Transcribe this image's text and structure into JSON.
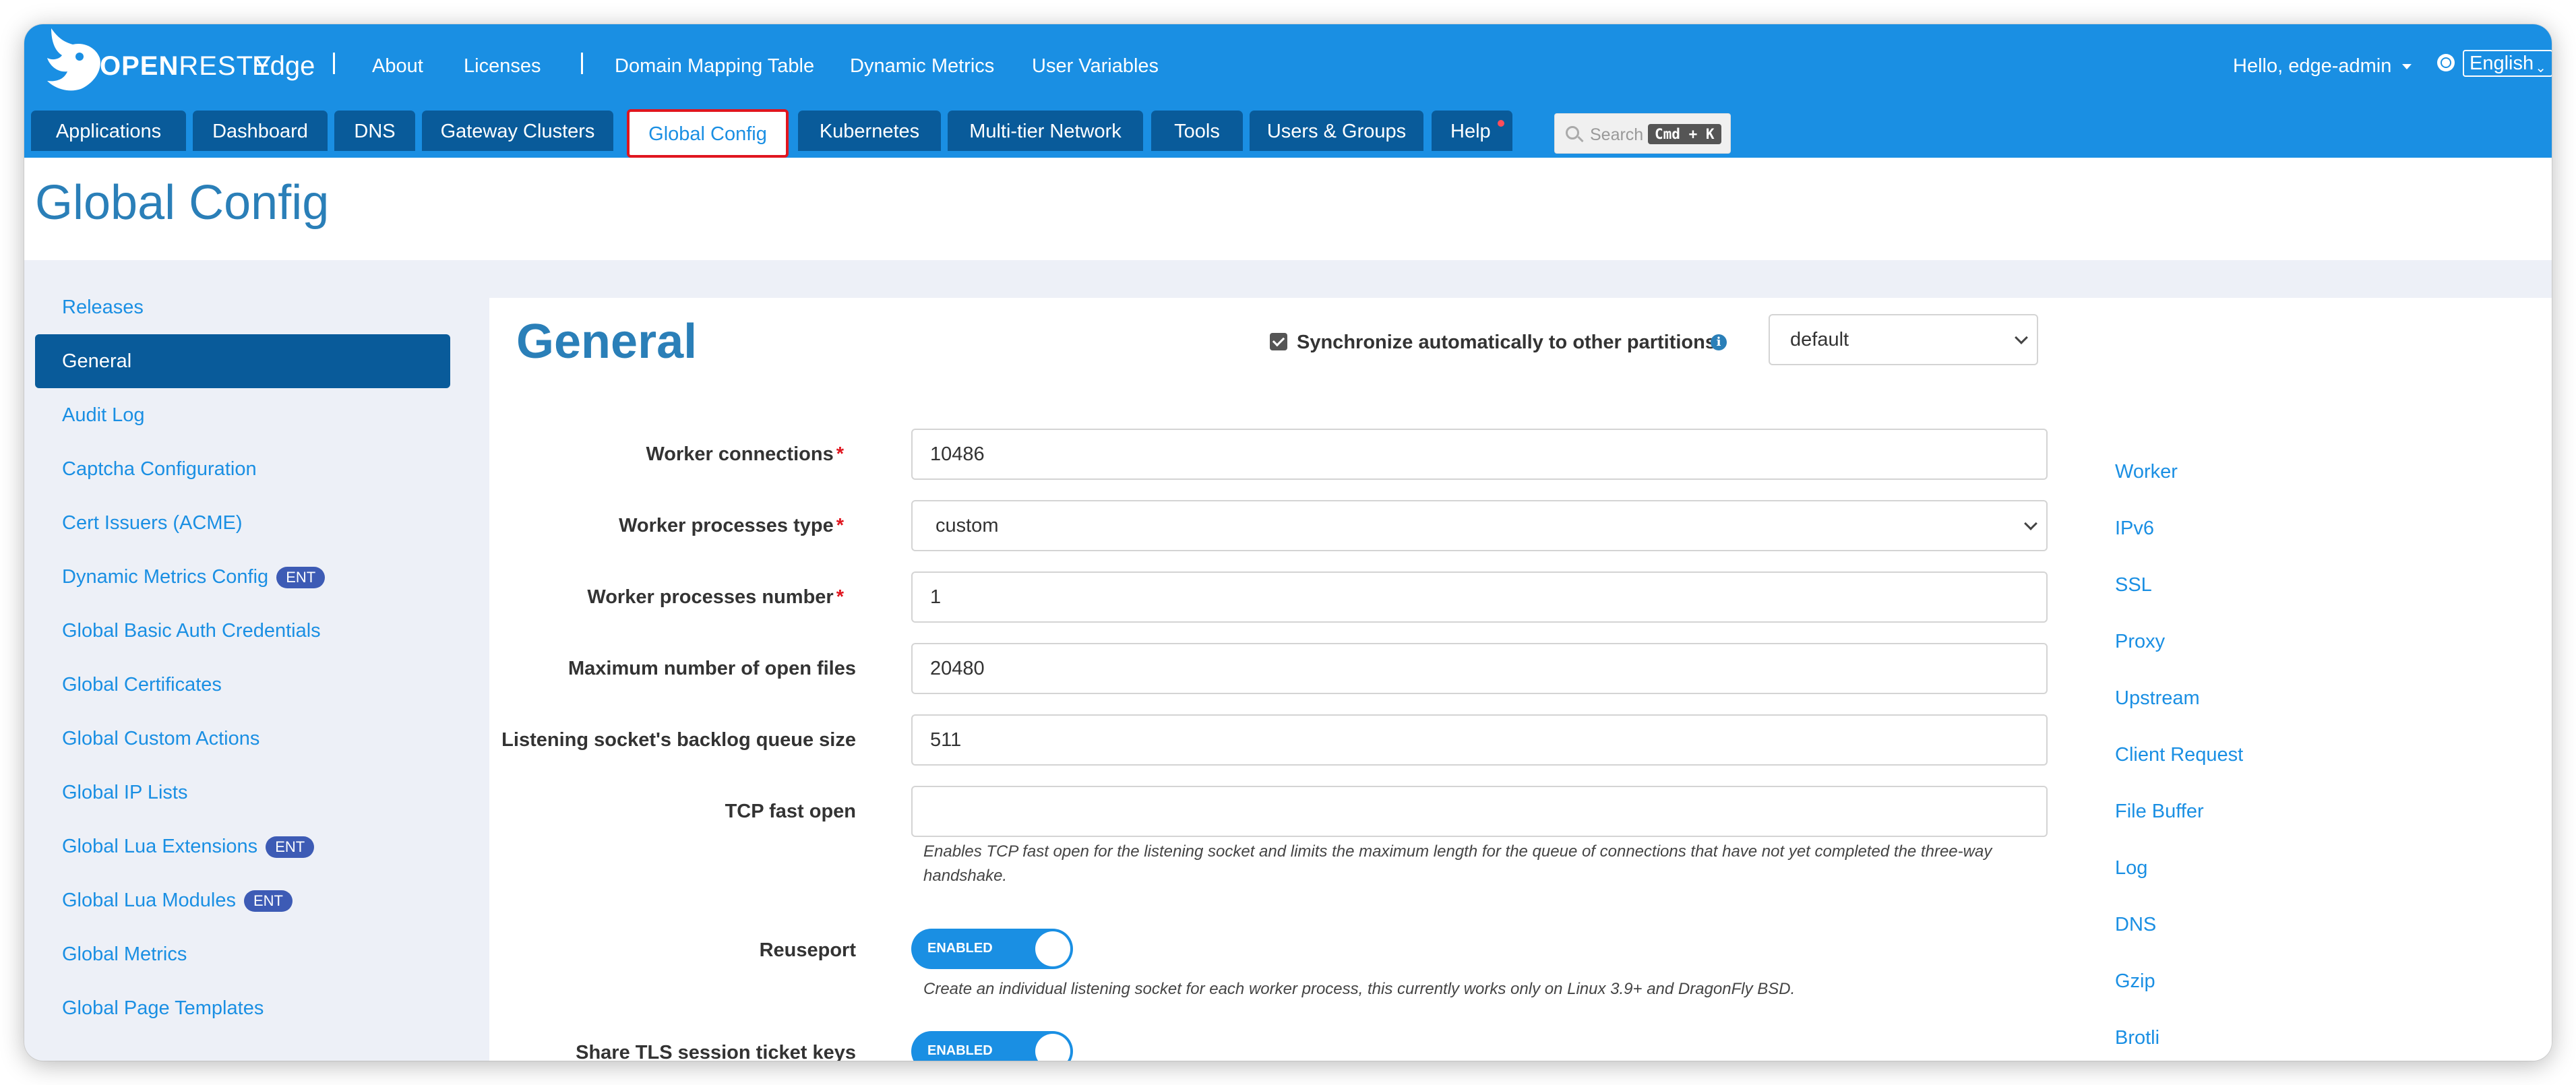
{
  "header": {
    "logo_text_bold": "OPEN",
    "logo_text_thin": "RESTY",
    "logo_product": "Edge",
    "nav": [
      "About",
      "Licenses",
      "Domain Mapping Table",
      "Dynamic Metrics",
      "User Variables"
    ],
    "user_greeting": "Hello, edge-admin",
    "language": "English"
  },
  "tabs": [
    {
      "label": "Applications"
    },
    {
      "label": "Dashboard"
    },
    {
      "label": "DNS"
    },
    {
      "label": "Gateway Clusters"
    },
    {
      "label": "Global Config",
      "active": true
    },
    {
      "label": "Kubernetes"
    },
    {
      "label": "Multi-tier Network"
    },
    {
      "label": "Tools"
    },
    {
      "label": "Users & Groups"
    },
    {
      "label": "Help",
      "notification_dot": true
    }
  ],
  "search": {
    "placeholder": "Search",
    "shortcut": "Cmd + K"
  },
  "page": {
    "title": "Global Config"
  },
  "sidebar": {
    "items": [
      {
        "label": "Releases"
      },
      {
        "label": "General",
        "active": true
      },
      {
        "label": "Audit Log"
      },
      {
        "label": "Captcha Configuration"
      },
      {
        "label": "Cert Issuers (ACME)"
      },
      {
        "label": "Dynamic Metrics Config",
        "badge": "ENT"
      },
      {
        "label": "Global Basic Auth Credentials"
      },
      {
        "label": "Global Certificates"
      },
      {
        "label": "Global Custom Actions"
      },
      {
        "label": "Global IP Lists"
      },
      {
        "label": "Global Lua Extensions",
        "badge": "ENT"
      },
      {
        "label": "Global Lua Modules",
        "badge": "ENT"
      },
      {
        "label": "Global Metrics"
      },
      {
        "label": "Global Page Templates"
      }
    ]
  },
  "general": {
    "title": "General",
    "sync_label": "Synchronize automatically to other partitions",
    "sync_checked": true,
    "partition": "default",
    "fields": {
      "worker_connections": {
        "label": "Worker connections",
        "value": "10486",
        "required": true
      },
      "worker_processes_type": {
        "label": "Worker processes type",
        "value": "custom",
        "required": true
      },
      "worker_processes_number": {
        "label": "Worker processes number",
        "value": "1",
        "required": true
      },
      "max_open_files": {
        "label": "Maximum number of open files",
        "value": "20480"
      },
      "backlog": {
        "label": "Listening socket's backlog queue size",
        "value": "511"
      },
      "tcp_fast_open": {
        "label": "TCP fast open",
        "value": "",
        "help": "Enables TCP fast open for the listening socket and limits the maximum length for the queue of connections that have not yet completed the three-way handshake."
      },
      "reuseport": {
        "label": "Reuseport",
        "toggle": "ENABLED",
        "help": "Create an individual listening socket for each worker process, this currently works only on Linux 3.9+ and DragonFly BSD."
      },
      "share_tls": {
        "label": "Share TLS session ticket keys",
        "toggle": "ENABLED"
      }
    },
    "required_mark": "*"
  },
  "anchor_nav": [
    "Worker",
    "IPv6",
    "SSL",
    "Proxy",
    "Upstream",
    "Client Request",
    "File Buffer",
    "Log",
    "DNS",
    "Gzip",
    "Brotli"
  ],
  "colors": {
    "header_bg": "#1a8fe3",
    "tab_bg": "#095b9a",
    "active_outline": "#e0161f",
    "link": "#1a8fe3",
    "title": "#2a7fb8"
  }
}
